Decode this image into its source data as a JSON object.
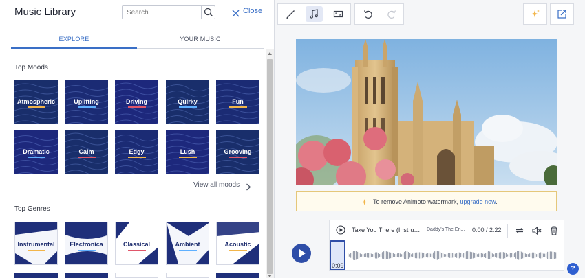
{
  "library": {
    "title": "Music Library",
    "search_placeholder": "Search",
    "search_value": "",
    "close_label": "Close",
    "tabs": [
      {
        "label": "EXPLORE",
        "active": true
      },
      {
        "label": "YOUR MUSIC",
        "active": false
      }
    ],
    "moods_title": "Top Moods",
    "moods": [
      {
        "label": "Atmospheric",
        "accent": "#f2b54a"
      },
      {
        "label": "Uplifting",
        "accent": "#5fb0ff"
      },
      {
        "label": "Driving",
        "accent": "#e0566a"
      },
      {
        "label": "Quirky",
        "accent": "#5fb0ff"
      },
      {
        "label": "Fun",
        "accent": "#f2b54a"
      },
      {
        "label": "Dramatic",
        "accent": "#5fb0ff"
      },
      {
        "label": "Calm",
        "accent": "#e0566a"
      },
      {
        "label": "Edgy",
        "accent": "#f2b54a"
      },
      {
        "label": "Lush",
        "accent": "#f2b54a"
      },
      {
        "label": "Grooving",
        "accent": "#e0566a"
      }
    ],
    "view_all_moods": "View all moods",
    "genres_title": "Top Genres",
    "genres": [
      {
        "label": "Instrumental",
        "accent": "#f2b54a"
      },
      {
        "label": "Electronica",
        "accent": "#5fb0ff"
      },
      {
        "label": "Classical",
        "accent": "#e0566a"
      },
      {
        "label": "Ambient",
        "accent": "#5fb0ff"
      },
      {
        "label": "Acoustic",
        "accent": "#f2b54a"
      }
    ]
  },
  "toolbar": {
    "edit_icon": "pencil-icon",
    "music_icon": "music-note-icon",
    "aspect_icon": "aspect-ratio-icon",
    "undo_icon": "undo-icon",
    "redo_icon": "redo-icon",
    "magic_icon": "sparkle-icon",
    "share_icon": "share-out-icon"
  },
  "watermark": {
    "text": "To remove Animoto watermark, ",
    "link": "upgrade now",
    "suffix": "."
  },
  "player": {
    "track": "Take You There (Instrum...",
    "artist": "Daddy's The En...",
    "time": "0:00 / 2:22",
    "selection_time": "0:09"
  },
  "colors": {
    "accent": "#3a6fc6",
    "tile_navy": "#1f2f7a",
    "play_blue": "#2f4ea8",
    "watermark_bg": "#fffbee"
  }
}
